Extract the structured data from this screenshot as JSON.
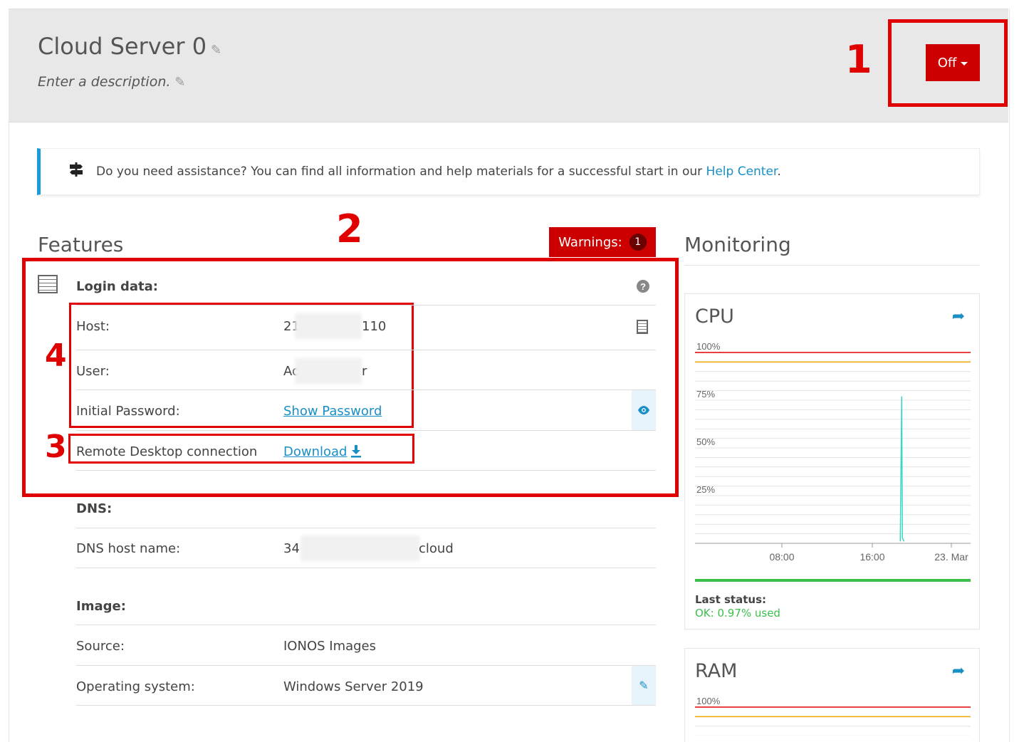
{
  "header": {
    "title": "Cloud Server 0",
    "description": "Enter a description.",
    "power_button": "Off"
  },
  "annotations": [
    "1",
    "2",
    "3",
    "4"
  ],
  "help": {
    "text": "Do you need assistance? You can find all information and help materials for a successful start in our ",
    "link": "Help Center",
    "after": "."
  },
  "features": {
    "title": "Features",
    "warnings_label": "Warnings:",
    "warnings_count": "1",
    "login": {
      "heading": "Login data:",
      "host_label": "Host:",
      "host_prefix": "21",
      "host_suffix": "110",
      "user_label": "User:",
      "user_prefix": "Ad",
      "user_suffix": "r",
      "password_label": "Initial Password:",
      "password_link": "Show Password",
      "rdp_label": "Remote Desktop connection",
      "rdp_link": "Download"
    },
    "dns": {
      "heading": "DNS:",
      "host_label": "DNS host name:",
      "host_prefix": "34",
      "host_suffix": "cloud"
    },
    "image": {
      "heading": "Image:",
      "source_label": "Source:",
      "source_value": "IONOS Images",
      "os_label": "Operating system:",
      "os_value": "Windows Server 2019"
    }
  },
  "monitoring": {
    "title": "Monitoring",
    "cpu": {
      "title": "CPU",
      "status_label": "Last status:",
      "status_value": "OK: 0.97% used"
    },
    "ram": {
      "title": "RAM"
    }
  },
  "chart_data": [
    {
      "type": "line",
      "title": "CPU",
      "y_tick_labels": [
        "100%",
        "75%",
        "50%",
        "25%"
      ],
      "x_tick_labels": [
        "08:00",
        "16:00",
        "23. Mar"
      ],
      "ylim": [
        0,
        100
      ],
      "thresholds": [
        {
          "color": "#e00000",
          "value": 100
        },
        {
          "color": "#f0a500",
          "value": 95
        }
      ],
      "series": [
        {
          "color": "#3dd6c4",
          "spike_at_fraction": 0.75,
          "spike_value": 77,
          "baseline": 1
        }
      ],
      "grid": true
    },
    {
      "type": "line",
      "title": "RAM",
      "y_tick_labels": [
        "100%"
      ],
      "thresholds": [
        {
          "color": "#e00000",
          "value": 100
        },
        {
          "color": "#f0a500",
          "value": 95
        }
      ],
      "grid": true
    }
  ]
}
